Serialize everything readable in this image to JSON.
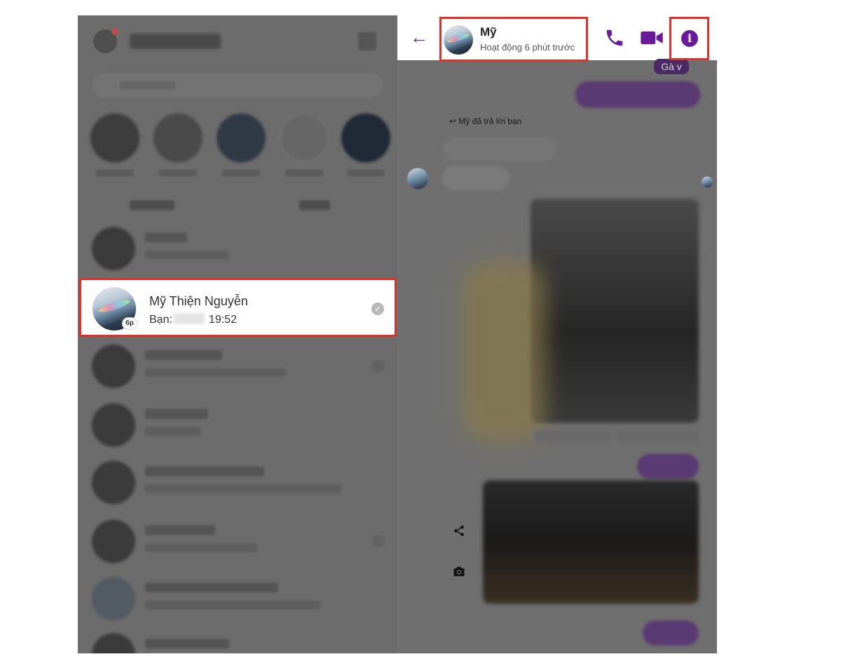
{
  "left_panel": {
    "selected_conversation": {
      "name": "Mỹ Thiện Nguyễn",
      "preview_prefix": "Bạn:",
      "preview_time": "19:52",
      "active_badge": "6p"
    }
  },
  "chat_header": {
    "name": "Mỹ",
    "status": "Hoạt động 6 phút trước"
  },
  "chat": {
    "reply_note": "Mỹ đã trả lời bạn",
    "top_bubble_text": "Gà v"
  },
  "icons": {
    "back": "arrow-left-icon",
    "call": "phone-icon",
    "video": "video-camera-icon",
    "info": "info-icon",
    "share": "share-icon",
    "camera": "camera-icon",
    "check": "check-circle-icon"
  },
  "colors": {
    "accent": "#6a1b9a",
    "highlight_border": "#e0312a",
    "dim_overlay": "#6c6c6c"
  }
}
